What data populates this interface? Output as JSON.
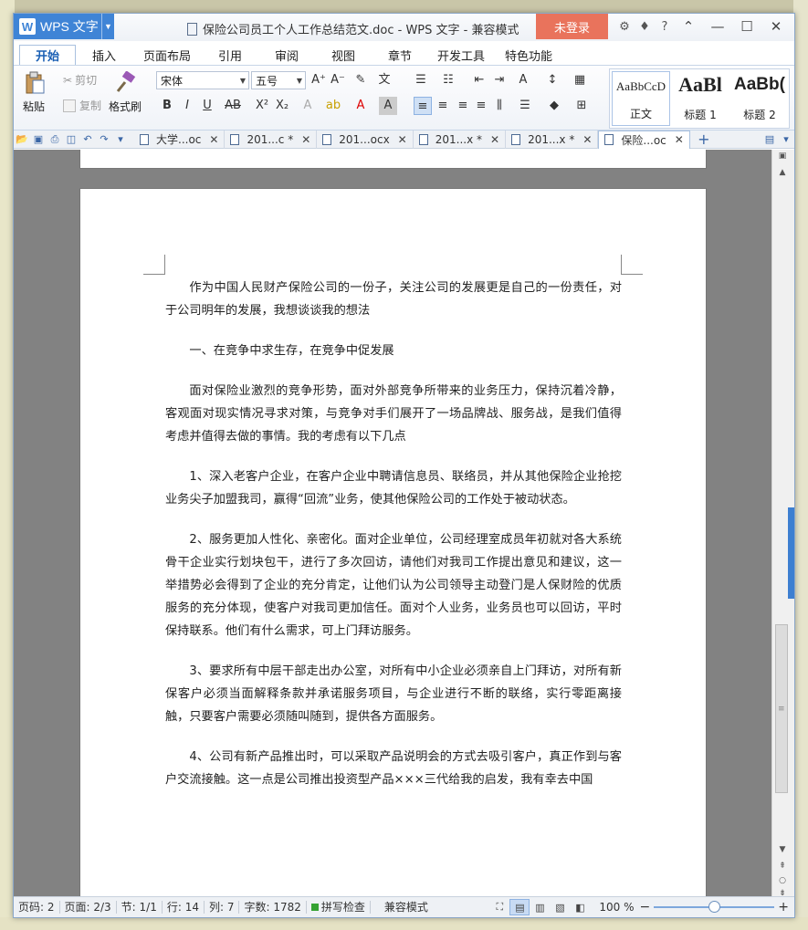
{
  "app": {
    "name": "WPS 文字",
    "window_title": "保险公司员工个人工作总结范文.doc - WPS 文字 - 兼容模式",
    "login_label": "未登录",
    "help_label": "?"
  },
  "menu_tabs": [
    "开始",
    "插入",
    "页面布局",
    "引用",
    "审阅",
    "视图",
    "章节",
    "开发工具",
    "特色功能"
  ],
  "ribbon": {
    "paste": "粘贴",
    "cut": "剪切",
    "copy": "复制",
    "format_painter": "格式刷",
    "font_name": "宋体",
    "font_size": "五号",
    "styles": [
      {
        "sample": "AaBbCcD",
        "name": "正文"
      },
      {
        "sample": "AaBl",
        "name": "标题 1"
      },
      {
        "sample": "AaBb(",
        "name": "标题 2"
      }
    ]
  },
  "doc_tabs": [
    {
      "label": "大学...oc",
      "active": false
    },
    {
      "label": "201...c *",
      "active": false
    },
    {
      "label": "201...ocx",
      "active": false
    },
    {
      "label": "201...x *",
      "active": false
    },
    {
      "label": "201...x *",
      "active": false
    },
    {
      "label": "保险...oc",
      "active": true
    }
  ],
  "document": {
    "paragraphs": [
      "作为中国人民财产保险公司的一份子，关注公司的发展更是自己的一份责任，对于公司明年的发展，我想谈谈我的想法",
      "一、在竞争中求生存，在竞争中促发展",
      "面对保险业激烈的竞争形势，面对外部竞争所带来的业务压力，保持沉着冷静，客观面对现实情况寻求对策，与竞争对手们展开了一场品牌战、服务战，是我们值得考虑并值得去做的事情。我的考虑有以下几点",
      "1、深入老客户企业，在客户企业中聘请信息员、联络员，并从其他保险企业抢挖业务尖子加盟我司，赢得“回流”业务，使其他保险公司的工作处于被动状态。",
      "2、服务更加人性化、亲密化。面对企业单位，公司经理室成员年初就对各大系统骨干企业实行划块包干，进行了多次回访，请他们对我司工作提出意见和建议，这一举措势必会得到了企业的充分肯定，让他们认为公司领导主动登门是人保财险的优质服务的充分体现，使客户对我司更加信任。面对个人业务，业务员也可以回访，平时保持联系。他们有什么需求，可上门拜访服务。",
      "3、要求所有中层干部走出办公室，对所有中小企业必须亲自上门拜访，对所有新保客户必须当面解释条款并承诺服务项目，与企业进行不断的联络，实行零距离接触，只要客户需要必须随叫随到，提供各方面服务。",
      "4、公司有新产品推出时，可以采取产品说明会的方式去吸引客户，真正作到与客户交流接触。这一点是公司推出投资型产品×××三代给我的启发，我有幸去中国"
    ]
  },
  "statusbar": {
    "page_num": "页码: 2",
    "pages": "页面: 2/3",
    "section": "节: 1/1",
    "row": "行: 14",
    "col": "列: 7",
    "words": "字数: 1782",
    "spell_check": "拼写检查",
    "compat": "兼容模式",
    "zoom": "100 %",
    "zoom_level": 0.5
  }
}
